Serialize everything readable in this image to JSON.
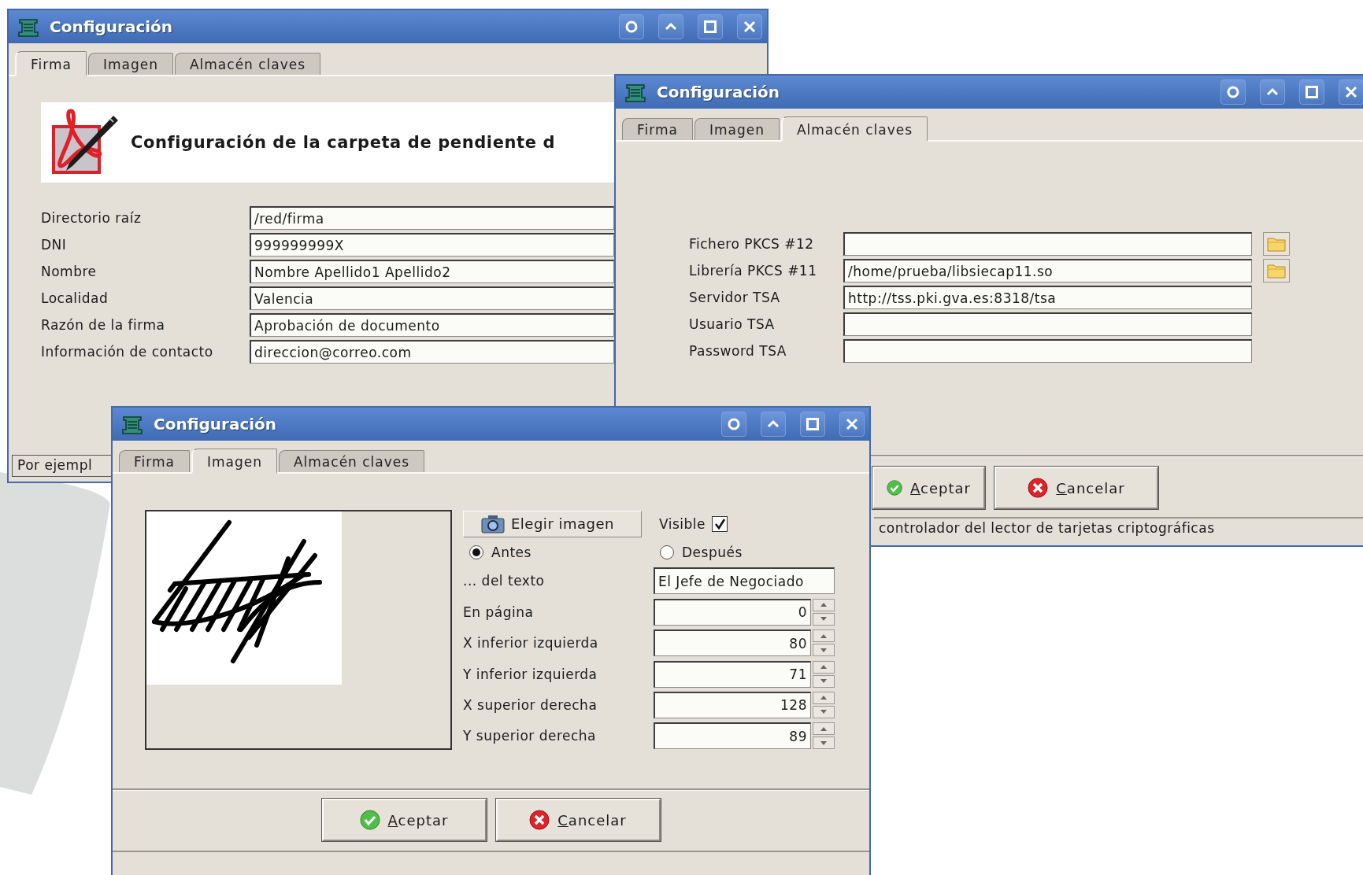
{
  "windows": [
    {
      "kind": "firma",
      "title": "Configuración",
      "tabs": [
        {
          "label": "Firma",
          "selected": true
        },
        {
          "label": "Imagen",
          "selected": false
        },
        {
          "label": "Almacén claves",
          "selected": false
        }
      ],
      "heading": "Configuración de la carpeta de pendiente d",
      "fields": [
        {
          "label": "Directorio raíz",
          "value": "/red/firma"
        },
        {
          "label": "DNI",
          "value": "999999999X"
        },
        {
          "label": "Nombre",
          "value": "Nombre Apellido1 Apellido2"
        },
        {
          "label": "Localidad",
          "value": "Valencia"
        },
        {
          "label": "Razón de la firma",
          "value": "Aprobación de documento"
        },
        {
          "label": "Información de contacto",
          "value": "direccion@correo.com"
        }
      ],
      "status_bar": "Por ejempl"
    },
    {
      "kind": "almacen",
      "title": "Configuración",
      "tabs": [
        {
          "label": "Firma",
          "selected": false
        },
        {
          "label": "Imagen",
          "selected": false
        },
        {
          "label": "Almacén claves",
          "selected": true
        }
      ],
      "fields": [
        {
          "label": "Fichero PKCS #12",
          "browse": true
        },
        {
          "label": "Librería PKCS #11",
          "value": "/home/prueba/libsiecap11.so",
          "browse": true
        },
        {
          "label": "Servidor TSA",
          "value": "http://tss.pki.gva.es:8318/tsa",
          "browse": false
        },
        {
          "label": "Usuario TSA",
          "browse": false
        },
        {
          "label": "Password TSA",
          "browse": false
        }
      ],
      "buttons": [
        {
          "label": "Aceptar",
          "kind": "ok"
        },
        {
          "label": "Cancelar",
          "kind": "cancel"
        }
      ],
      "status_bar": "controlador del lector de tarjetas criptográficas"
    },
    {
      "kind": "imagen",
      "title": "Configuración",
      "tabs": [
        {
          "label": "Firma",
          "selected": false
        },
        {
          "label": "Imagen",
          "selected": true
        },
        {
          "label": "Almacén claves",
          "selected": false
        }
      ],
      "choose_button": "Elegir imagen",
      "visible": {
        "label": "Visible",
        "checked": true
      },
      "position": [
        {
          "label": "Antes",
          "selected": true
        },
        {
          "label": "Después",
          "selected": false
        }
      ],
      "text_field": {
        "label": "... del texto",
        "value": "El Jefe de Negociado"
      },
      "spinners": [
        {
          "label": "En página",
          "value": "0"
        },
        {
          "label": "X inferior izquierda",
          "value": "80"
        },
        {
          "label": "Y inferior izquierda",
          "value": "71"
        },
        {
          "label": "X superior derecha",
          "value": "128"
        },
        {
          "label": "Y superior derecha",
          "value": "89"
        }
      ],
      "buttons": [
        {
          "label": "Aceptar",
          "kind": "ok"
        },
        {
          "label": "Cancelar",
          "kind": "cancel"
        }
      ]
    }
  ]
}
